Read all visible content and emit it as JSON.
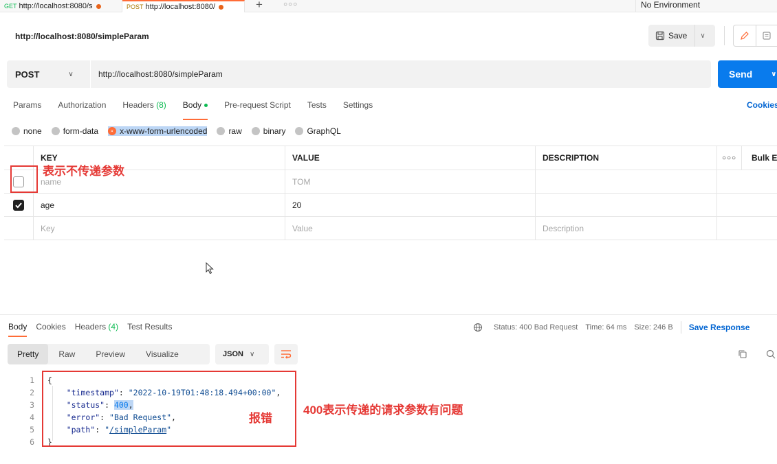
{
  "tabs": [
    {
      "method": "GET",
      "url": "http://localhost:8080/s"
    },
    {
      "method": "POST",
      "url": "http://localhost:8080/"
    }
  ],
  "environment": "No Environment",
  "request": {
    "title": "http://localhost:8080/simpleParam",
    "method": "POST",
    "url": "http://localhost:8080/simpleParam",
    "save_label": "Save",
    "send_label": "Send"
  },
  "request_tabs": {
    "params": "Params",
    "authorization": "Authorization",
    "headers": "Headers",
    "headers_count": "(8)",
    "body": "Body",
    "prerequest": "Pre-request Script",
    "tests": "Tests",
    "settings": "Settings",
    "cookies": "Cookies"
  },
  "body_types": {
    "none": "none",
    "form_data": "form-data",
    "urlencoded": "x-www-form-urlencoded",
    "raw": "raw",
    "binary": "binary",
    "graphql": "GraphQL"
  },
  "params_table": {
    "headers": {
      "key": "KEY",
      "value": "VALUE",
      "description": "DESCRIPTION",
      "bulk": "Bulk E"
    },
    "rows": [
      {
        "key": "name",
        "value": "TOM",
        "checked": false
      },
      {
        "key": "age",
        "value": "20",
        "checked": true
      }
    ],
    "placeholders": {
      "key": "Key",
      "value": "Value",
      "description": "Description"
    }
  },
  "annotations": {
    "unchecked_note": "表示不传递参数",
    "error_note": "报错",
    "status_note": "400表示传递的请求参数有问题"
  },
  "response": {
    "tabs": {
      "body": "Body",
      "cookies": "Cookies",
      "headers": "Headers",
      "headers_count": "(4)",
      "test_results": "Test Results"
    },
    "status": "Status: 400 Bad Request",
    "time": "Time: 64 ms",
    "size": "Size: 246 B",
    "save_response": "Save Response",
    "formats": {
      "pretty": "Pretty",
      "raw": "Raw",
      "preview": "Preview",
      "visualize": "Visualize"
    },
    "language": "JSON",
    "line_numbers": [
      "1",
      "2",
      "3",
      "4",
      "5",
      "6"
    ],
    "json": {
      "open": "{",
      "timestamp_key": "\"timestamp\"",
      "timestamp_val": "\"2022-10-19T01:48:18.494+00:00\"",
      "status_key": "\"status\"",
      "status_val": "400",
      "error_key": "\"error\"",
      "error_val": "\"Bad Request\"",
      "path_key": "\"path\"",
      "path_val": "/simpleParam",
      "close": "}"
    }
  },
  "colors": {
    "accent": "#ff6c37",
    "send": "#097bed",
    "annotation": "#e53935",
    "link": "#0265d2"
  }
}
